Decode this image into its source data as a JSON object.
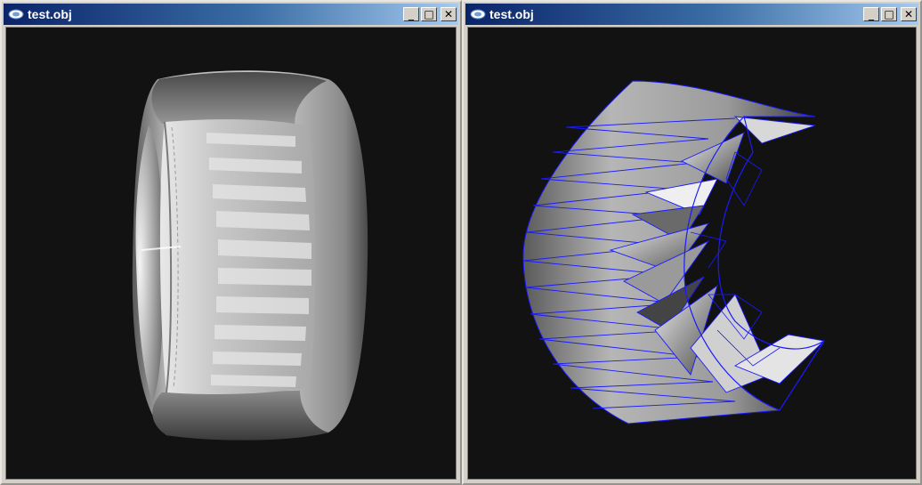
{
  "windows": [
    {
      "id": "left",
      "title": "test.obj",
      "controls": {
        "minimize": "_",
        "maximize": "□",
        "close": "✕"
      },
      "render_mode": "smooth-shaded"
    },
    {
      "id": "right",
      "title": "test.obj",
      "controls": {
        "minimize": "_",
        "maximize": "□",
        "close": "✕"
      },
      "render_mode": "shaded-with-wireframe"
    }
  ],
  "colors": {
    "titlebar_start": "#0a246a",
    "titlebar_end": "#a6caf0",
    "viewport_bg": "#121212",
    "wireframe": "#1a1aff",
    "window_face": "#d4d0c8"
  }
}
